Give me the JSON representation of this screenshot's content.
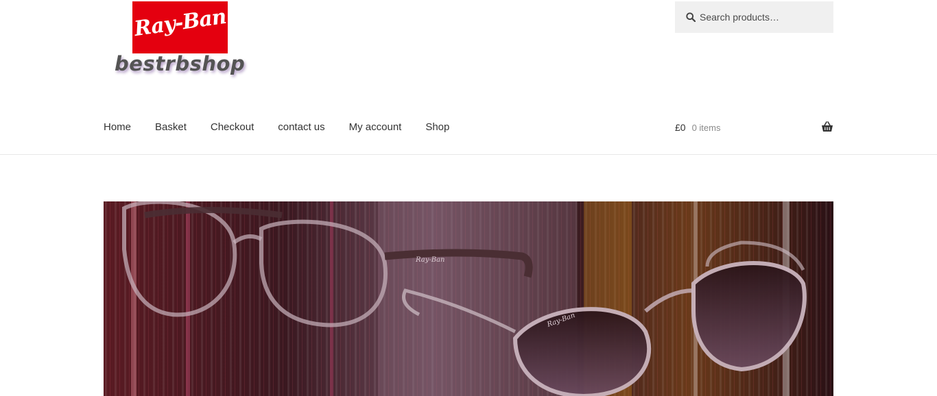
{
  "logo": {
    "brand": "Ray-Ban",
    "subtitle": "bestrbshop"
  },
  "search": {
    "placeholder": "Search products…",
    "icon": "search-icon"
  },
  "nav": {
    "items": [
      {
        "label": "Home"
      },
      {
        "label": "Basket"
      },
      {
        "label": "Checkout"
      },
      {
        "label": "contact us"
      },
      {
        "label": "My account"
      },
      {
        "label": "Shop"
      }
    ]
  },
  "cart": {
    "amount": "£0",
    "count": "0 items",
    "icon": "basket-icon"
  },
  "hero": {
    "alt": "Ray-Ban eyeglasses banner",
    "brand_mark": "Ray-Ban"
  },
  "colors": {
    "brand_red": "#e4000f",
    "header_bg": "#ffffff",
    "search_bg": "#f0f0f0"
  }
}
